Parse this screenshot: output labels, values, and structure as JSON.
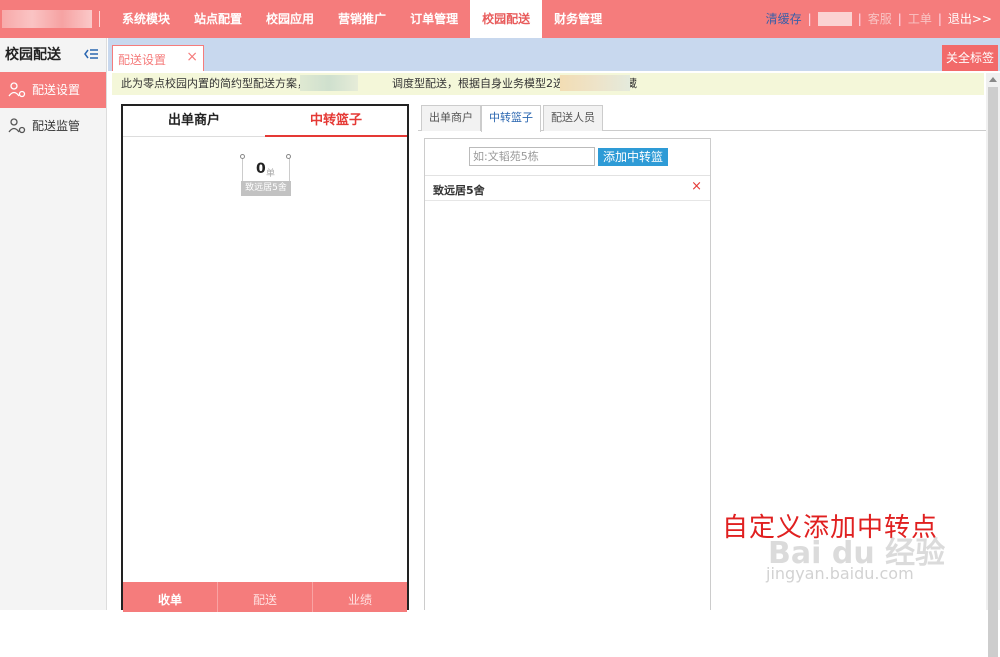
{
  "topbar": {
    "nav": [
      "系统模块",
      "站点配置",
      "校园应用",
      "营销推广",
      "订单管理",
      "校园配送",
      "财务管理"
    ],
    "active_nav_index": 5,
    "clear_cache": "清缓存",
    "customer_service": "客服",
    "ticket": "工单",
    "logout": "退出>>",
    "separator": "|"
  },
  "sidebar": {
    "title": "校园配送",
    "items": [
      {
        "label": "配送设置",
        "icon": "delivery-setting-icon"
      },
      {
        "label": "配送监管",
        "icon": "delivery-monitor-icon"
      }
    ]
  },
  "tabstrip": {
    "page_tab": "配送设置",
    "close_glyph": "×",
    "close_all": "关全标签"
  },
  "notice": {
    "part1": "此为零点校园内置的简约型配送方案，不同",
    "part2": "调度型配送，根据自身业务模型2选1即可。请收藏"
  },
  "phone": {
    "tabs": [
      "出单商户",
      "中转篮子"
    ],
    "active_tab_index": 1,
    "basket": {
      "count": "0",
      "unit": "单",
      "name": "致远居5舍"
    },
    "bottom_tabs": [
      "收单",
      "配送",
      "业绩"
    ]
  },
  "config": {
    "tabs": [
      "出单商户",
      "中转篮子",
      "配送人员"
    ],
    "active_tab_index": 1,
    "search_placeholder": "如:文韬苑5栋",
    "add_button": "添加中转篮",
    "baskets": [
      {
        "name": "致远居5舍",
        "delete": "×"
      }
    ]
  },
  "caption": "自定义添加中转点",
  "watermark": {
    "line1": "Bai du 经验",
    "line2": "jingyan.baidu.com"
  },
  "colors": {
    "brand": "#f57c7c",
    "accent_red": "#e53935",
    "link_blue": "#2a66b0",
    "button_blue": "#2e9bd6"
  }
}
